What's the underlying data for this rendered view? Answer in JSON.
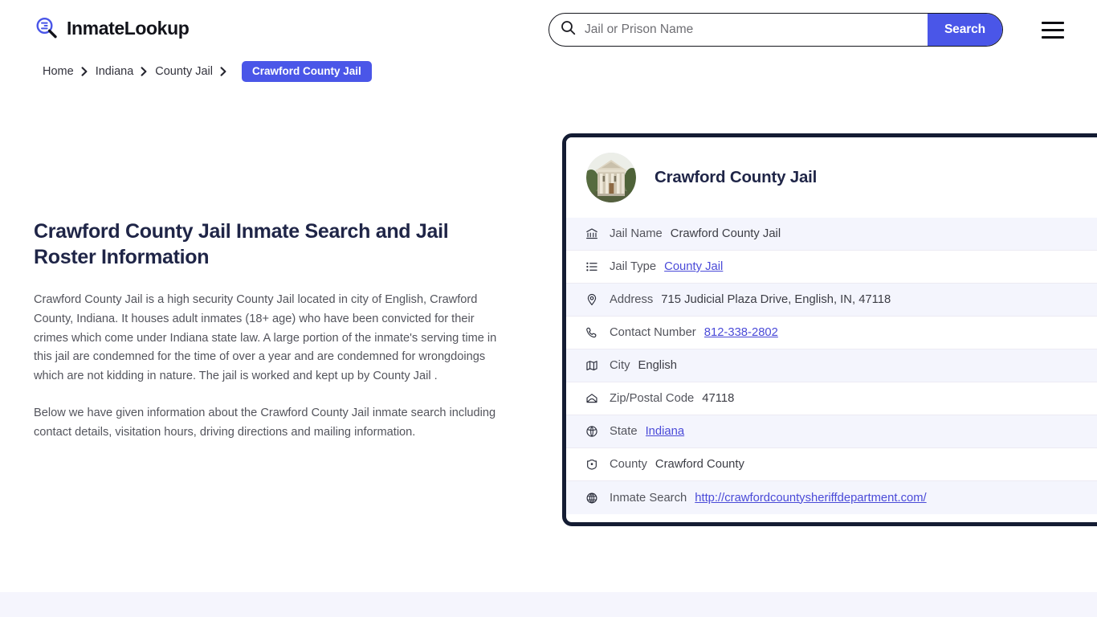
{
  "header": {
    "brand_name": "InmateLookup",
    "brand_icon": "magnifier-logo-icon",
    "search": {
      "icon": "search-icon",
      "placeholder": "Jail or Prison Name",
      "value": "",
      "button_label": "Search"
    },
    "menu_icon": "hamburger-menu-icon"
  },
  "breadcrumb": {
    "items": [
      {
        "label": "Home"
      },
      {
        "label": "Indiana"
      },
      {
        "label": "County Jail"
      }
    ],
    "current": "Crawford County Jail",
    "separator_icon": "chevron-right-icon"
  },
  "main": {
    "title": "Crawford County Jail Inmate Search and Jail Roster Information",
    "paragraphs": [
      "Crawford County Jail is a high security County Jail located in city of English, Crawford County, Indiana. It houses adult inmates (18+ age) who have been convicted for their crimes which come under Indiana state law. A large portion of the inmate's serving time in this jail are condemned for the time of over a year and are condemned for wrongdoings which are not kidding in nature. The jail is worked and kept up by County Jail .",
      "Below we have given information about the Crawford County Jail inmate search including contact details, visitation hours, driving directions and mailing information."
    ]
  },
  "card": {
    "avatar_icon": "courthouse-photo",
    "title": "Crawford County Jail",
    "rows": [
      {
        "icon": "bank-building-icon",
        "label": "Jail Name",
        "value": "Crawford County Jail",
        "link": false
      },
      {
        "icon": "list-icon",
        "label": "Jail Type",
        "value": "County Jail",
        "link": true
      },
      {
        "icon": "location-pin-icon",
        "label": "Address",
        "value": "715 Judicial Plaza Drive, English, IN, 47118",
        "link": false
      },
      {
        "icon": "phone-icon",
        "label": "Contact Number",
        "value": "812-338-2802",
        "link": true
      },
      {
        "icon": "map-icon",
        "label": "City",
        "value": "English",
        "link": false
      },
      {
        "icon": "envelope-icon",
        "label": "Zip/Postal Code",
        "value": "47118",
        "link": false
      },
      {
        "icon": "globe-icon",
        "label": "State",
        "value": "Indiana",
        "link": true
      },
      {
        "icon": "county-shield-icon",
        "label": "County",
        "value": "Crawford County",
        "link": false
      },
      {
        "icon": "web-globe-icon",
        "label": "Inmate Search",
        "value": "http://crawfordcountysheriffdepartment.com/",
        "link": true
      }
    ]
  },
  "colors": {
    "accent": "#4a56e8",
    "card_border": "#141c33",
    "heading": "#1f2547",
    "row_alt": "#f4f5fd",
    "link": "#4a4ad8",
    "footer_band": "#f5f5fd"
  }
}
